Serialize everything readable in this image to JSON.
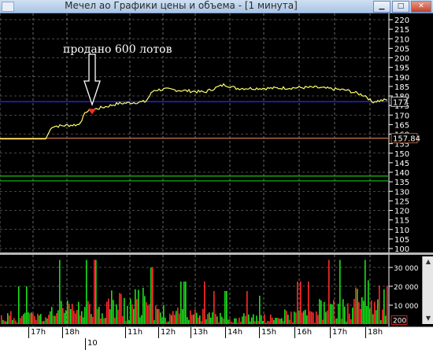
{
  "window": {
    "title": "Мечел ао Графики цены и объема - [1 минута]",
    "controls": [
      "minimize",
      "maximize",
      "close"
    ]
  },
  "annotation": {
    "text": "продано 600 лотов"
  },
  "price_axis": {
    "ticks": [
      "220",
      "215",
      "210",
      "205",
      "200",
      "195",
      "190",
      "185",
      "180",
      "175",
      "170",
      "165",
      "160",
      "155",
      "150",
      "145",
      "140",
      "135",
      "130",
      "125",
      "120",
      "115",
      "110",
      "105",
      "100"
    ],
    "current_label": "177",
    "level_label": "157.84"
  },
  "volume_axis": {
    "ticks": [
      "30 000",
      "20 000",
      "10 000"
    ],
    "current_label": "200"
  },
  "time_axis": {
    "labels": [
      "17h",
      "18h",
      "11h",
      "12h",
      "13h",
      "14h",
      "15h",
      "16h",
      "17h",
      "18h"
    ],
    "date_label": "10"
  },
  "colors": {
    "background": "#000000",
    "price_line": "#ffff66",
    "grid": "#ffffff",
    "blue_level": "#2b2bff",
    "orange_level": "#d07a4a",
    "green_level": "#19c219",
    "marker": "#ff2a2a",
    "volume_up": "#19e019",
    "volume_down": "#ff2a2a"
  },
  "chart_data": [
    {
      "type": "line",
      "series": [
        {
          "x": [
            "17h",
            "18h",
            "11h",
            "12h",
            "13h",
            "14h",
            "15h",
            "16h",
            "17h",
            "18h"
          ],
          "values": [
            157.5,
            172,
            175.5,
            183,
            182,
            185,
            184,
            184.5,
            183,
            177
          ]
        }
      ],
      "ylim": [
        100,
        220
      ],
      "reference_levels": [
        {
          "value": 177,
          "color": "blue"
        },
        {
          "value": 157.84,
          "color": "orange"
        },
        {
          "value": 138,
          "color": "green"
        },
        {
          "value": 135.5,
          "color": "green"
        }
      ],
      "marker": {
        "x": "18h",
        "value": 172,
        "label": "продано 600 лотов"
      },
      "grid": true
    },
    {
      "type": "bar",
      "categories": [
        "17h",
        "18h",
        "11h",
        "12h",
        "13h",
        "14h",
        "15h",
        "16h",
        "17h",
        "18h"
      ],
      "values": [
        8000,
        14000,
        22000,
        12000,
        9000,
        7000,
        6000,
        9000,
        15000,
        26000
      ],
      "ylim": [
        0,
        35000
      ],
      "grid": true
    }
  ]
}
